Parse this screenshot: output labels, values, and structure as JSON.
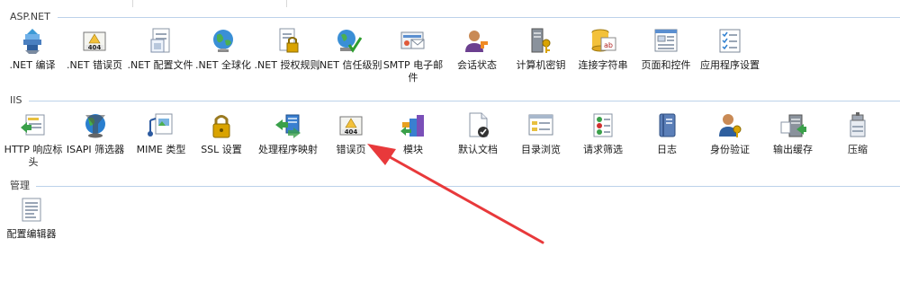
{
  "groups": {
    "aspnet": {
      "title": "ASP.NET",
      "items": [
        {
          "label": ".NET 编译",
          "icon": "net-compile-icon"
        },
        {
          "label": ".NET 错误页",
          "icon": "net-error-page-icon"
        },
        {
          "label": ".NET 配置文件",
          "icon": "net-profile-icon"
        },
        {
          "label": ".NET 全球化",
          "icon": "globe-icon"
        },
        {
          "label": ".NET 授权规则",
          "icon": "authorization-icon"
        },
        {
          "label": ".NET 信任级别",
          "icon": "trust-level-icon"
        },
        {
          "label": "SMTP 电子邮件",
          "icon": "smtp-mail-icon"
        },
        {
          "label": "会话状态",
          "icon": "session-state-icon"
        },
        {
          "label": "计算机密钥",
          "icon": "machine-key-icon"
        },
        {
          "label": "连接字符串",
          "icon": "connection-string-icon"
        },
        {
          "label": "页面和控件",
          "icon": "pages-controls-icon"
        },
        {
          "label": "应用程序设置",
          "icon": "app-settings-icon"
        }
      ]
    },
    "iis": {
      "title": "IIS",
      "items": [
        {
          "label": "HTTP 响应标头",
          "icon": "http-headers-icon"
        },
        {
          "label": "ISAPI 筛选器",
          "icon": "isapi-filter-icon"
        },
        {
          "label": "MIME 类型",
          "icon": "mime-type-icon"
        },
        {
          "label": "SSL 设置",
          "icon": "lock-icon"
        },
        {
          "label": "处理程序映射",
          "icon": "handler-mapping-icon"
        },
        {
          "label": "错误页",
          "icon": "error-page-icon"
        },
        {
          "label": "模块",
          "icon": "modules-icon"
        },
        {
          "label": "默认文档",
          "icon": "default-document-icon"
        },
        {
          "label": "目录浏览",
          "icon": "directory-browsing-icon"
        },
        {
          "label": "请求筛选",
          "icon": "request-filter-icon"
        },
        {
          "label": "日志",
          "icon": "logging-icon"
        },
        {
          "label": "身份验证",
          "icon": "authentication-icon"
        },
        {
          "label": "输出缓存",
          "icon": "output-cache-icon"
        },
        {
          "label": "压缩",
          "icon": "compression-icon"
        }
      ]
    },
    "management": {
      "title": "管理",
      "items": [
        {
          "label": "配置编辑器",
          "icon": "config-editor-icon"
        }
      ]
    }
  },
  "badge_404": "404",
  "colors": {
    "annotation_arrow": "#e8393b",
    "group_line": "#bcd2ea"
  }
}
